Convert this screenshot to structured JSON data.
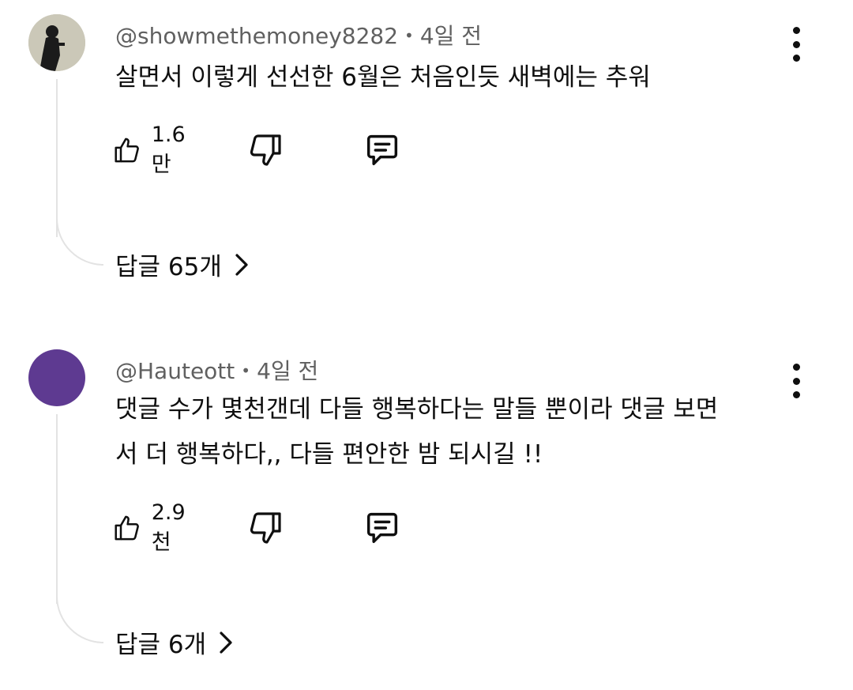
{
  "comments": [
    {
      "author": "@showmethemoney8282",
      "time": "4일 전",
      "text": "살면서 이렇게 선선한 6월은 처음인듯 새벽에는 추워",
      "likes": "1.6만",
      "replies_label": "답글 65개",
      "avatar_color": "#bdb9a8"
    },
    {
      "author": "@Hauteott",
      "time": "4일 전",
      "text": "댓글 수가 몇천갠데 다들 행복하다는 말들 뿐이라 댓글 보면서 더 행복하다,, 다들 편안한 밤 되시길 !!",
      "likes": "2.9천",
      "replies_label": "답글 6개",
      "avatar_color": "#5e3a91"
    }
  ],
  "separator": "•",
  "icons": {
    "like": "thumbs-up-icon",
    "dislike": "thumbs-down-icon",
    "reply": "comment-icon",
    "menu": "more-vert-icon",
    "chevron": "chevron-right-icon"
  }
}
